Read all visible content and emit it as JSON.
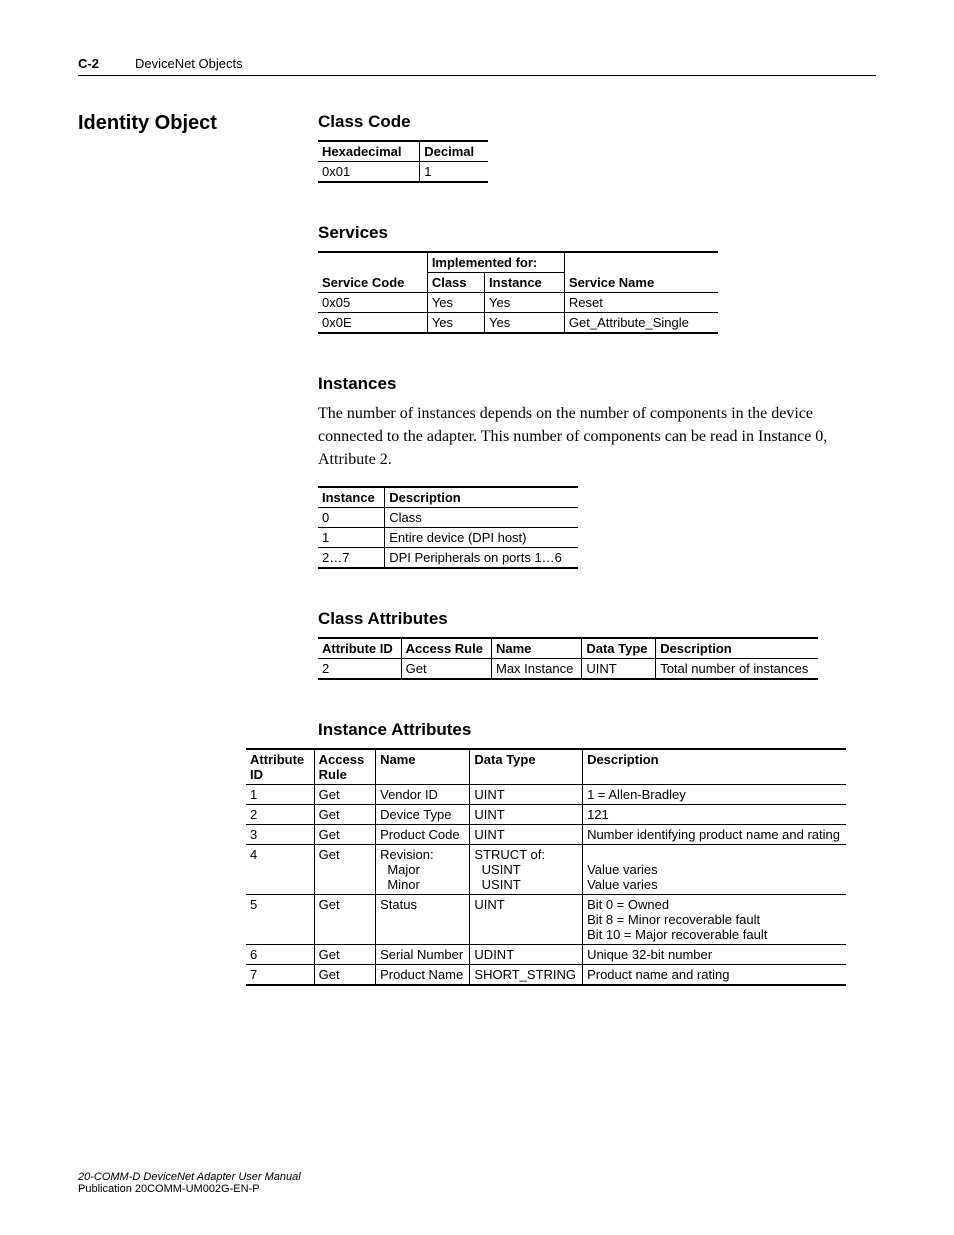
{
  "header": {
    "page_num": "C-2",
    "chapter": "DeviceNet Objects"
  },
  "section_title": "Identity Object",
  "class_code": {
    "title": "Class Code",
    "headers": [
      "Hexadecimal",
      "Decimal"
    ],
    "row": [
      "0x01",
      "1"
    ]
  },
  "services": {
    "title": "Services",
    "group_header": "Implemented for:",
    "headers": [
      "Service Code",
      "Class",
      "Instance",
      "Service Name"
    ],
    "rows": [
      [
        "0x05",
        "Yes",
        "Yes",
        "Reset"
      ],
      [
        "0x0E",
        "Yes",
        "Yes",
        "Get_Attribute_Single"
      ]
    ]
  },
  "instances": {
    "title": "Instances",
    "para": "The number of instances depends on the number of components in the device connected to the adapter. This number of components can be read in Instance 0, Attribute 2.",
    "headers": [
      "Instance",
      "Description"
    ],
    "rows": [
      [
        "0",
        "Class"
      ],
      [
        "1",
        "Entire device (DPI host)"
      ],
      [
        "2…7",
        "DPI Peripherals on ports 1…6"
      ]
    ]
  },
  "class_attrs": {
    "title": "Class Attributes",
    "headers": [
      "Attribute ID",
      "Access Rule",
      "Name",
      "Data Type",
      "Description"
    ],
    "rows": [
      [
        "2",
        "Get",
        "Max Instance",
        "UINT",
        "Total number of instances"
      ]
    ]
  },
  "inst_attrs": {
    "title": "Instance Attributes",
    "headers": [
      "Attribute ID",
      "Access Rule",
      "Name",
      "Data Type",
      "Description"
    ],
    "rows": [
      [
        "1",
        "Get",
        "Vendor ID",
        "UINT",
        "1 = Allen-Bradley"
      ],
      [
        "2",
        "Get",
        "Device Type",
        "UINT",
        "121"
      ],
      [
        "3",
        "Get",
        "Product Code",
        "UINT",
        "Number identifying product name and rating"
      ],
      [
        "4",
        "Get",
        "Revision:\n  Major\n  Minor",
        "STRUCT of:\n  USINT\n  USINT",
        "\nValue varies\nValue varies"
      ],
      [
        "5",
        "Get",
        "Status",
        "UINT",
        "Bit 0 = Owned\nBit 8 = Minor recoverable fault\nBit 10 = Major recoverable fault"
      ],
      [
        "6",
        "Get",
        "Serial Number",
        "UDINT",
        "Unique 32-bit number"
      ],
      [
        "7",
        "Get",
        "Product Name",
        "SHORT_STRING",
        "Product name and rating"
      ]
    ]
  },
  "footer": {
    "line1": "20-COMM-D DeviceNet Adapter User Manual",
    "line2": "Publication 20COMM-UM002G-EN-P"
  }
}
